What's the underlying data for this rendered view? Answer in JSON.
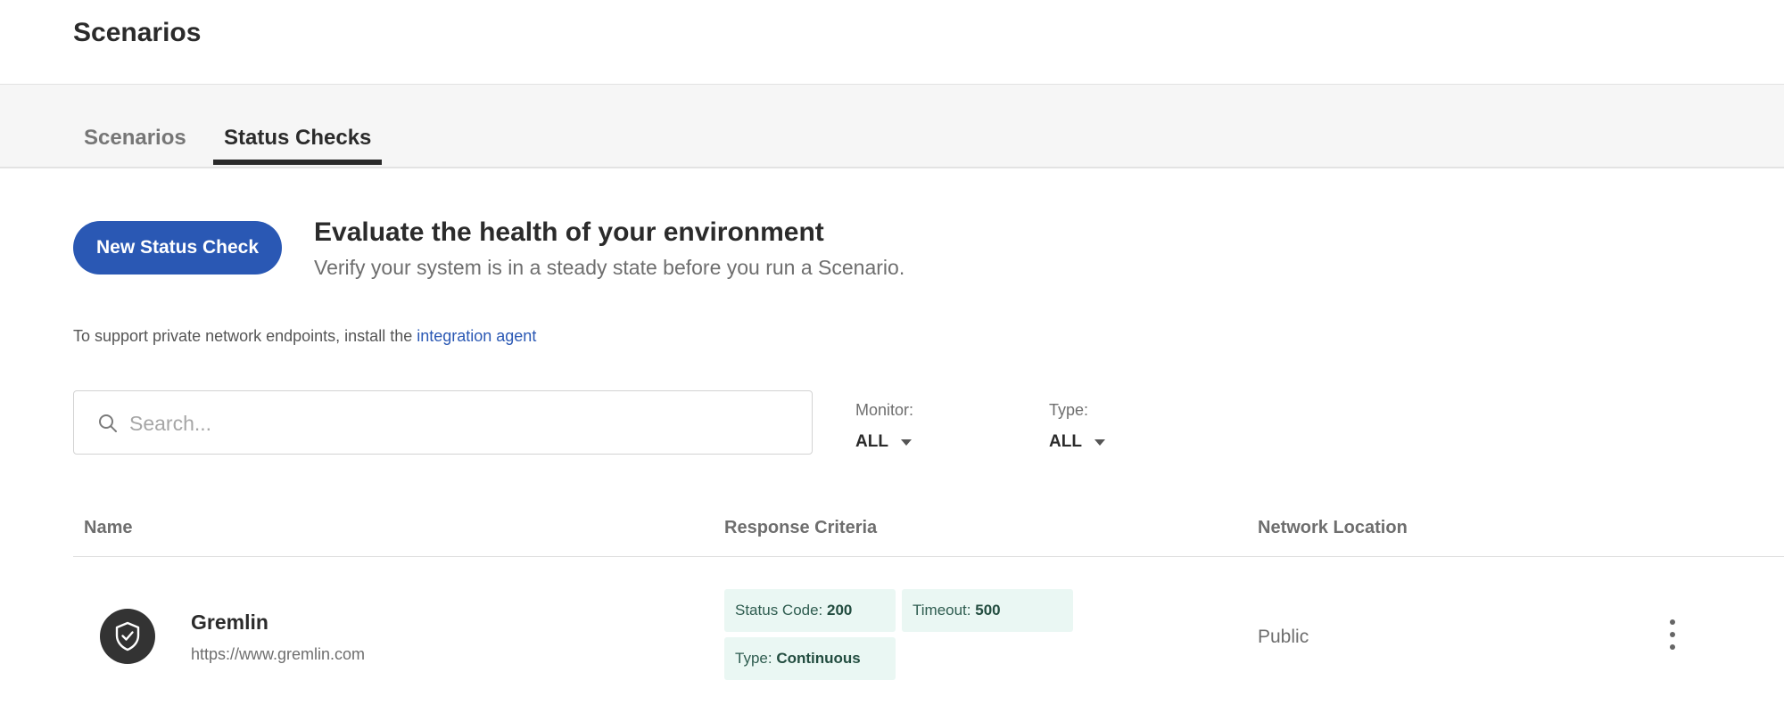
{
  "header": {
    "title": "Scenarios"
  },
  "tabs": [
    {
      "label": "Scenarios",
      "active": false
    },
    {
      "label": "Status Checks",
      "active": true
    }
  ],
  "actions": {
    "new_button": "New Status Check"
  },
  "intro": {
    "headline": "Evaluate the health of your environment",
    "subline": "Verify your system is in a steady state before you run a Scenario."
  },
  "private_note": {
    "text": "To support private network endpoints, install the ",
    "link": "integration agent"
  },
  "search": {
    "placeholder": "Search...",
    "value": "",
    "icon": "search-icon"
  },
  "filters": {
    "monitor": {
      "label": "Monitor:",
      "value": "ALL"
    },
    "type": {
      "label": "Type:",
      "value": "ALL"
    }
  },
  "table": {
    "columns": [
      "Name",
      "Response Criteria",
      "Network Location"
    ],
    "rows": [
      {
        "icon": "shield-check-icon",
        "name": "Gremlin",
        "url": "https://www.gremlin.com",
        "criteria": [
          {
            "key": "Status Code:",
            "value": "200"
          },
          {
            "key": "Timeout:",
            "value": "500"
          },
          {
            "key": "Type:",
            "value": "Continuous"
          }
        ],
        "location": "Public"
      }
    ]
  },
  "colors": {
    "primary": "#2a58b4",
    "chip_bg": "#eaf7f3",
    "chip_text": "#2f5d50"
  }
}
